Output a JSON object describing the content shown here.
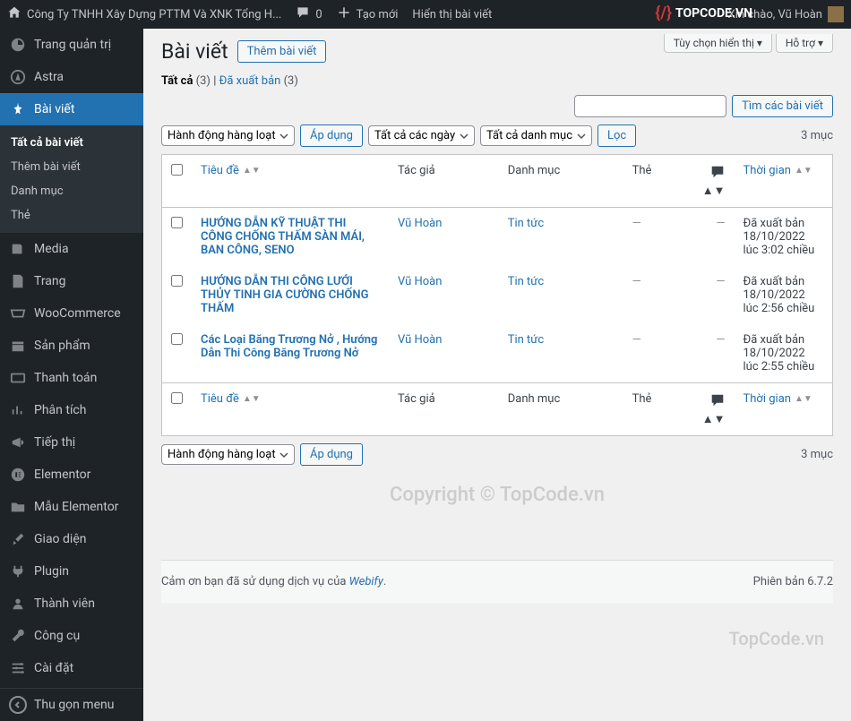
{
  "topbar": {
    "site_name": "Công Ty TNHH Xây Dựng PTTM Và XNK Tổng H...",
    "comment_count": "0",
    "new_label": "Tạo mới",
    "view_label": "Hiển thị bài viết",
    "greeting": "Xin chào, Vũ Hoàn",
    "logo_text": "TOPCODE.VN"
  },
  "sidebar": {
    "dashboard": "Trang quản trị",
    "astra": "Astra",
    "posts": "Bài viết",
    "submenu": {
      "all": "Tất cả bài viết",
      "add": "Thêm bài viết",
      "categories": "Danh mục",
      "tags": "Thẻ"
    },
    "media": "Media",
    "pages": "Trang",
    "woocommerce": "WooCommerce",
    "products": "Sản phẩm",
    "payments": "Thanh toán",
    "analytics": "Phân tích",
    "marketing": "Tiếp thị",
    "elementor": "Elementor",
    "elementor_templates": "Mẫu Elementor",
    "appearance": "Giao diện",
    "plugins": "Plugin",
    "users": "Thành viên",
    "tools": "Công cụ",
    "settings": "Cài đặt",
    "collapse": "Thu gọn menu"
  },
  "screen_opts": {
    "options": "Tùy chọn hiển thị",
    "help": "Hỗ trợ"
  },
  "page": {
    "title": "Bài viết",
    "add_new": "Thêm bài viết"
  },
  "filters": {
    "all_label": "Tất cả",
    "all_count": "(3)",
    "sep": " | ",
    "published_label": "Đã xuất bản",
    "published_count": "(3)"
  },
  "search": {
    "button": "Tìm các bài viết"
  },
  "bulk": {
    "action": "Hành động hàng loạt",
    "apply": "Áp dụng",
    "all_dates": "Tất cả các ngày",
    "all_categories": "Tất cả danh mục",
    "filter": "Lọc",
    "count": "3 mục"
  },
  "columns": {
    "title": "Tiêu đề",
    "author": "Tác giả",
    "categories": "Danh mục",
    "tags": "Thẻ",
    "date": "Thời gian"
  },
  "rows": [
    {
      "title": "HƯỚNG DẪN KỸ THUẬT THI CÔNG CHỐNG THẤM SÀN MÁI, BAN CÔNG, SENO",
      "author": "Vũ Hoàn",
      "category": "Tin tức",
      "tag": "—",
      "status": "Đã xuất bản",
      "date": "18/10/2022 lúc 3:02 chiều"
    },
    {
      "title": "HƯỚNG DẪN THI CÔNG LƯỚI THỦY TINH GIA CƯỜNG CHỐNG THẤM",
      "author": "Vũ Hoàn",
      "category": "Tin tức",
      "tag": "—",
      "status": "Đã xuất bản",
      "date": "18/10/2022 lúc 2:56 chiều"
    },
    {
      "title": "Các Loại Băng Trương Nở , Hướng Dẫn Thi Công Băng Trương Nở",
      "author": "Vũ Hoàn",
      "category": "Tin tức",
      "tag": "—",
      "status": "Đã xuất bản",
      "date": "18/10/2022 lúc 2:55 chiều"
    }
  ],
  "footer": {
    "thanks": "Cảm ơn bạn đã sử dụng dịch vụ của ",
    "link": "Webify",
    "version": "Phiên bản 6.7.2"
  },
  "watermark": {
    "right": "TopCode.vn",
    "center": "Copyright © TopCode.vn"
  }
}
